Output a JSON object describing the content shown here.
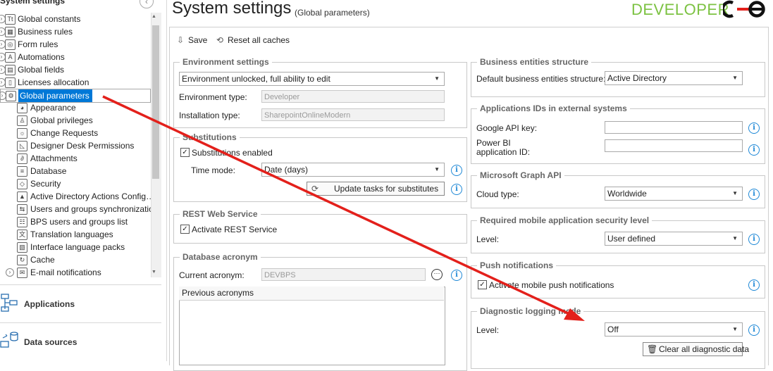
{
  "sidebar": {
    "title": "System settings",
    "tree": [
      {
        "label": "Global constants",
        "icon": "constants-icon",
        "glyph": "Tt"
      },
      {
        "label": "Business rules",
        "icon": "rules-icon",
        "glyph": "▦"
      },
      {
        "label": "Form rules",
        "icon": "form-rules-icon",
        "glyph": "◎"
      },
      {
        "label": "Automations",
        "icon": "automations-icon",
        "glyph": "A"
      },
      {
        "label": "Global fields",
        "icon": "fields-icon",
        "glyph": "▤"
      },
      {
        "label": "Licenses allocation",
        "icon": "license-icon",
        "glyph": "▯"
      },
      {
        "label": "Global parameters",
        "icon": "gear-icon",
        "glyph": "⚙"
      },
      {
        "label": "Appearance",
        "icon": "palette-icon",
        "glyph": "◕"
      },
      {
        "label": "Global privileges",
        "icon": "privileges-icon",
        "glyph": "♙"
      },
      {
        "label": "Change Requests",
        "icon": "lightbulb-icon",
        "glyph": "☼"
      },
      {
        "label": "Designer Desk Permissions",
        "icon": "ruler-icon",
        "glyph": "◺"
      },
      {
        "label": "Attachments",
        "icon": "paperclip-icon",
        "glyph": "∂"
      },
      {
        "label": "Database",
        "icon": "database-icon",
        "glyph": "≡"
      },
      {
        "label": "Security",
        "icon": "shield-icon",
        "glyph": "◇"
      },
      {
        "label": "Active Directory Actions Config…",
        "icon": "ad-actions-icon",
        "glyph": "▲"
      },
      {
        "label": "Users and groups synchronization",
        "icon": "sync-icon",
        "glyph": "⇆"
      },
      {
        "label": "BPS users and groups list",
        "icon": "users-list-icon",
        "glyph": "☷"
      },
      {
        "label": "Translation languages",
        "icon": "translate-icon",
        "glyph": "文"
      },
      {
        "label": "Interface language packs",
        "icon": "language-pack-icon",
        "glyph": "▧"
      },
      {
        "label": "Cache",
        "icon": "cache-icon",
        "glyph": "↻"
      },
      {
        "label": "E-mail notifications",
        "icon": "mail-icon",
        "glyph": "✉"
      }
    ],
    "nav": [
      {
        "label": "Applications"
      },
      {
        "label": "Data sources"
      }
    ]
  },
  "header": {
    "title": "System settings",
    "subtitle": "(Global parameters)",
    "brand": "DEVELOPER"
  },
  "toolbar": {
    "save": "Save",
    "reset": "Reset all caches"
  },
  "environment": {
    "title": "Environment settings",
    "mode": "Environment unlocked, full ability to edit",
    "type_label": "Environment type:",
    "type_value": "Developer",
    "install_label": "Installation type:",
    "install_value": "SharepointOnlineModern"
  },
  "substitutions": {
    "title": "Substitutions",
    "enabled_label": "Substitutions enabled",
    "enabled": true,
    "time_label": "Time mode:",
    "time_value": "Date (days)",
    "update_button": "Update tasks for substitutes"
  },
  "rest": {
    "title": "REST Web Service",
    "activate_label": "Activate REST Service",
    "enabled": true
  },
  "acronym": {
    "title": "Database acronym",
    "current_label": "Current acronym:",
    "current_value": "DEVBPS",
    "previous_header": "Previous acronyms",
    "more": "···"
  },
  "business_entities": {
    "title": "Business entities structure",
    "label": "Default business entities structure:",
    "value": "Active Directory"
  },
  "app_ids": {
    "title": "Applications IDs in external systems",
    "google_label": "Google API key:",
    "google_value": "",
    "powerbi_label_1": "Power BI",
    "powerbi_label_2": "application ID:",
    "powerbi_value": ""
  },
  "graph": {
    "title": "Microsoft Graph API",
    "cloud_label": "Cloud type:",
    "cloud_value": "Worldwide"
  },
  "mobile_security": {
    "title": "Required mobile application security level",
    "level_label": "Level:",
    "level_value": "User defined"
  },
  "push": {
    "title": "Push notifications",
    "activate_label": "Activate mobile push notifications",
    "enabled": true
  },
  "diagnostic": {
    "title": "Diagnostic logging mode",
    "level_label": "Level:",
    "level_value": "Off",
    "clear_button": "Clear all diagnostic data"
  },
  "colors": {
    "accent": "#0078d7",
    "brand": "#7cc242",
    "info": "#1e88d6",
    "annotation_arrow": "#e3201b"
  }
}
